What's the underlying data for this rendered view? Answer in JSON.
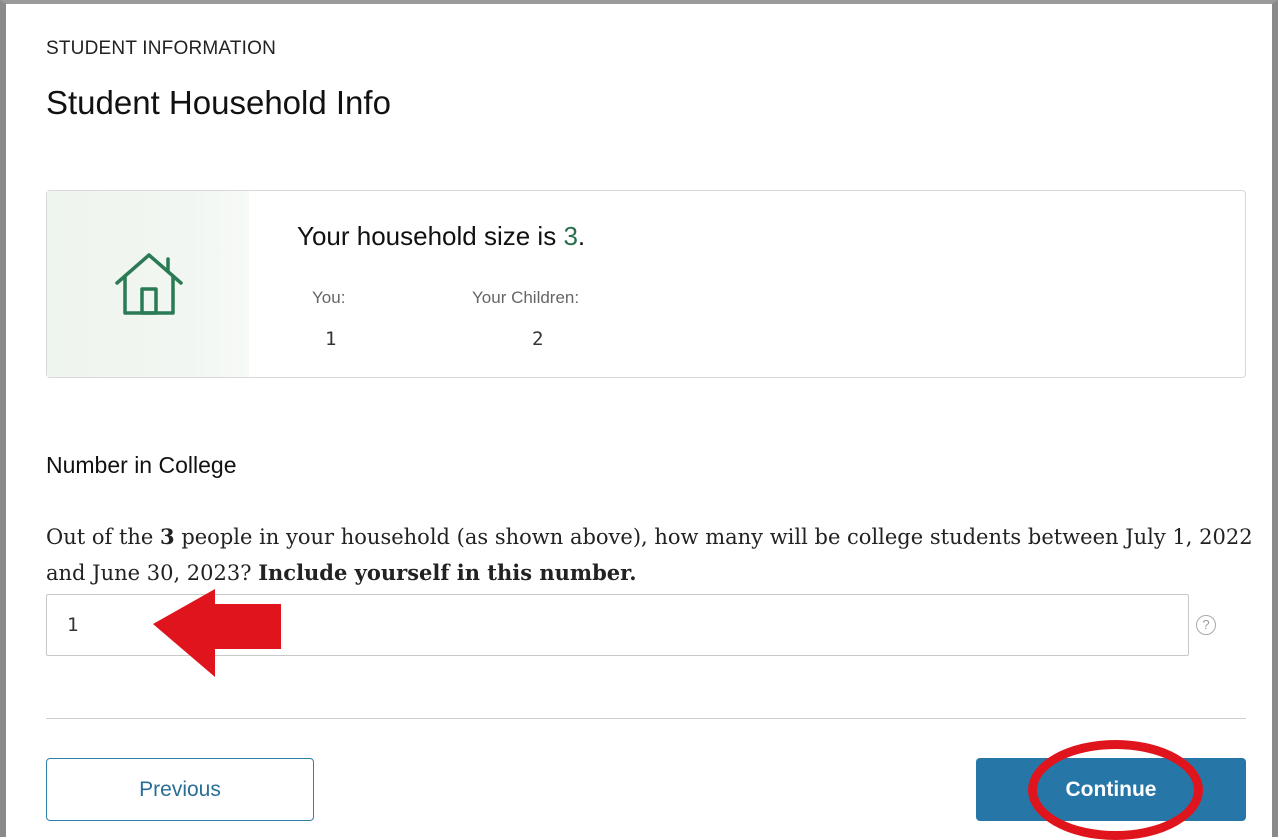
{
  "header": {
    "section_label": "STUDENT INFORMATION",
    "title": "Student Household Info"
  },
  "household_card": {
    "heading_prefix": "Your household size is ",
    "household_size": "3",
    "heading_suffix": ".",
    "icon": "house-icon",
    "stats": [
      {
        "label": "You:",
        "value": "1"
      },
      {
        "label": "Your Children:",
        "value": "2"
      }
    ]
  },
  "number_in_college": {
    "heading": "Number in College",
    "question_part1": "Out of the ",
    "question_count": "3",
    "question_part2": " people in your household (as shown above), how many will be college students between July 1, 2022 and June 30, 2023? ",
    "question_emphasis": "Include yourself in this number.",
    "input_value": "1",
    "help_icon_glyph": "?"
  },
  "footer": {
    "previous_label": "Previous",
    "continue_label": "Continue"
  },
  "colors": {
    "accent_green": "#2a6e4e",
    "button_blue": "#2676a8",
    "annotation_red": "#e0141c"
  }
}
